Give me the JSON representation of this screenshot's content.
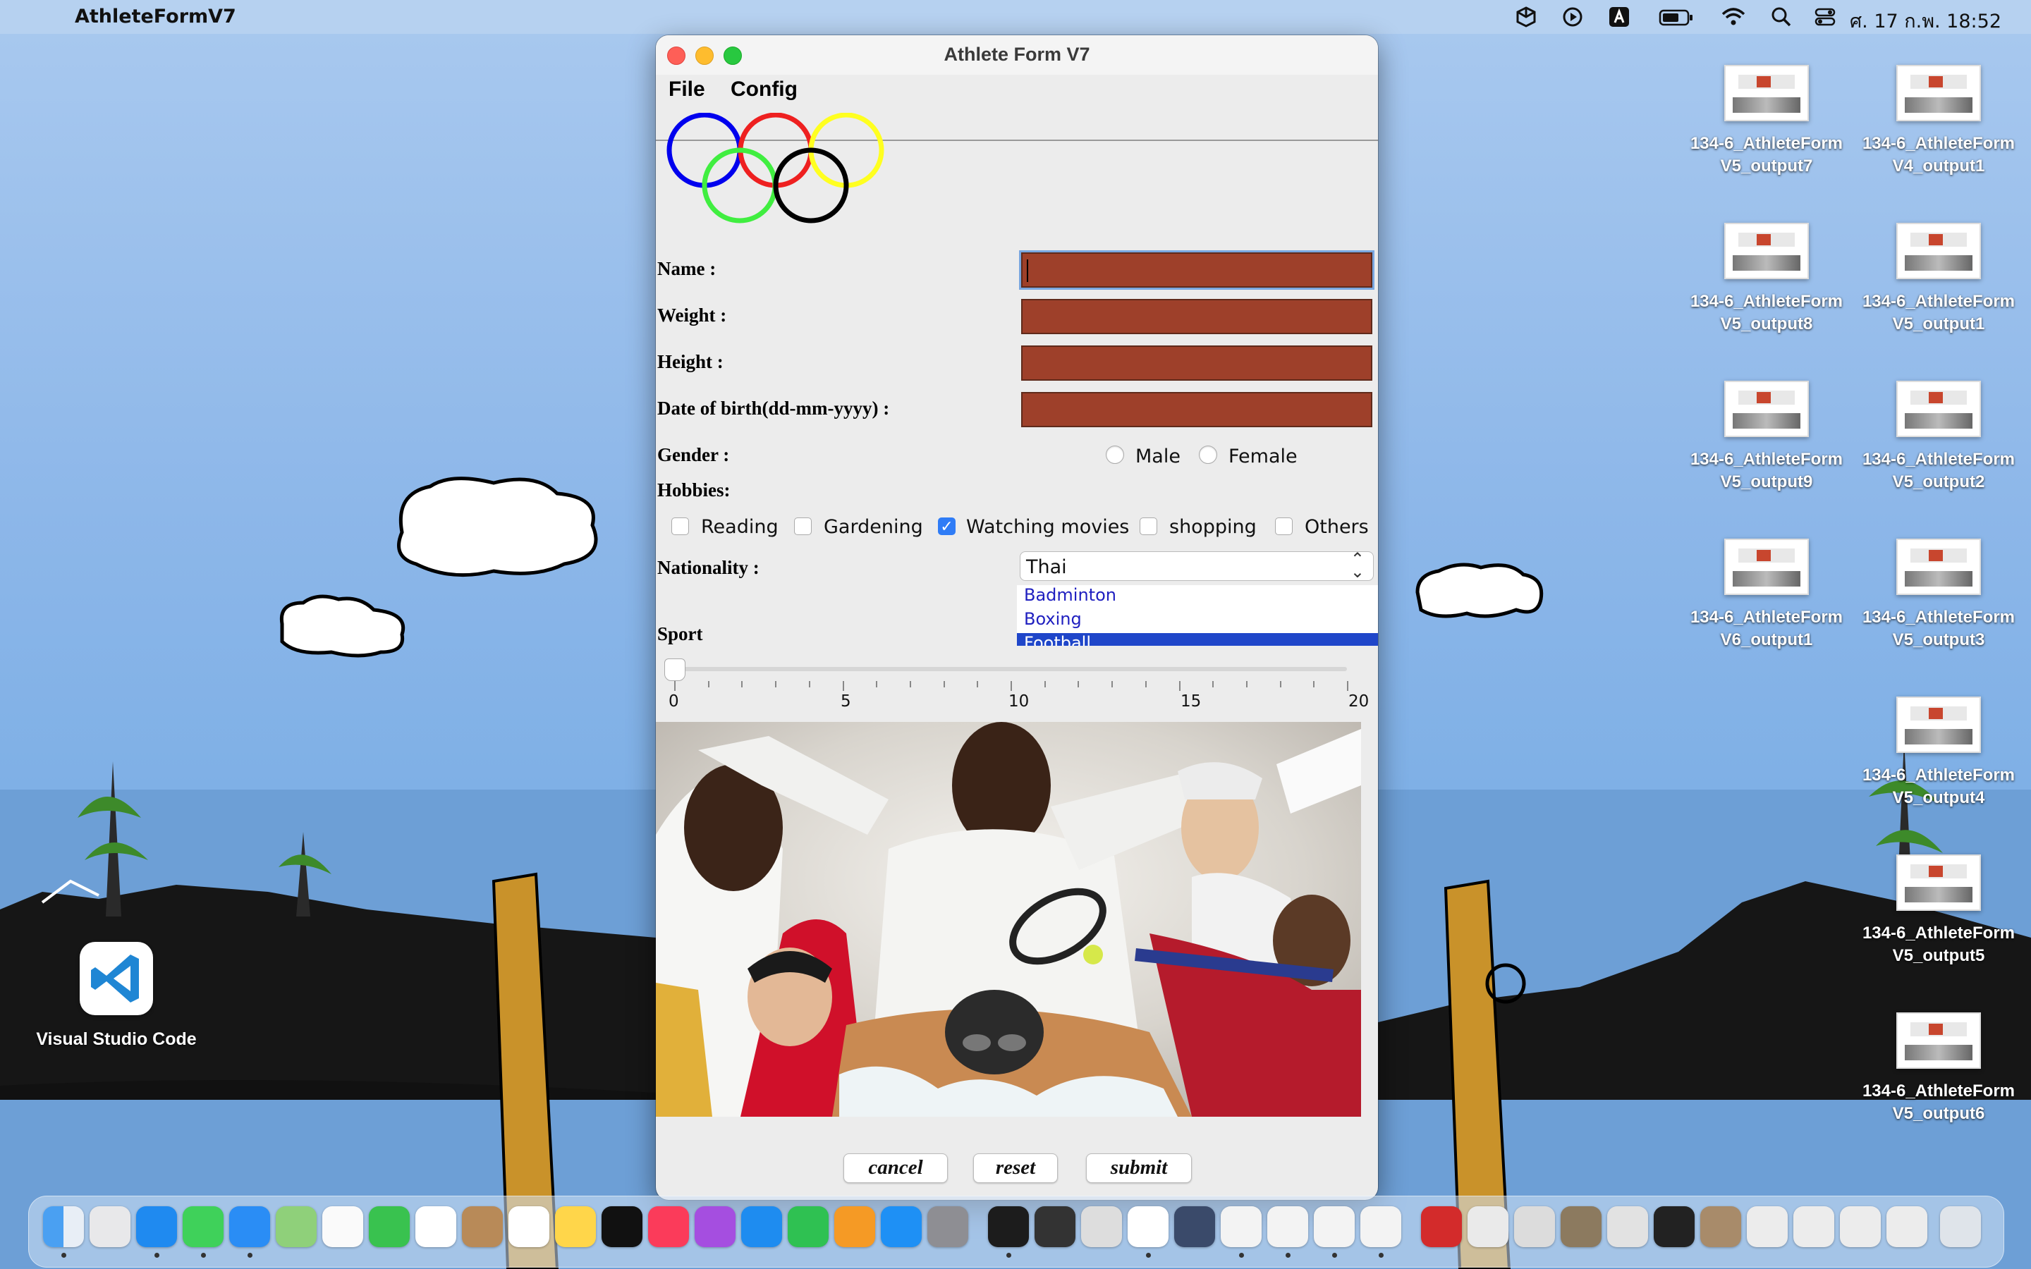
{
  "menubar": {
    "app_name": "AthleteFormV7",
    "clock": "ศ. 17 ก.พ.  18:52",
    "status_icons": [
      "cube-icon",
      "play-icon",
      "keyboard-input-icon",
      "battery-icon",
      "wifi-icon",
      "search-icon",
      "control-center-icon"
    ]
  },
  "desktop": {
    "files": [
      "134-6_AthleteFormV5_output7",
      "134-6_AthleteFormV4_output1",
      "134-6_AthleteFormV5_output8",
      "134-6_AthleteFormV5_output1",
      "134-6_AthleteFormV5_output9",
      "134-6_AthleteFormV5_output2",
      "134-6_AthleteFormV6_output1",
      "134-6_AthleteFormV5_output3",
      "134-6_AthleteFormV5_output4",
      "134-6_AthleteFormV5_output5",
      "134-6_AthleteFormV5_output6"
    ],
    "vscode_label": "Visual Studio Code"
  },
  "window": {
    "title": "Athlete Form V7",
    "menu": {
      "file": "File",
      "config": "Config"
    },
    "labels": {
      "name": "Name :",
      "weight": "Weight :",
      "height": "Height :",
      "dob": "Date of birth(dd-mm-yyyy) :",
      "gender": "Gender :",
      "hobbies": "Hobbies:",
      "nationality": "Nationality :",
      "sport": "Sport"
    },
    "fields": {
      "name": "",
      "weight": "",
      "height": "",
      "dob": ""
    },
    "gender_options": {
      "male": "Male",
      "female": "Female"
    },
    "hobbies": {
      "reading": "Reading",
      "gardening": "Gardening",
      "watching": "Watching movies",
      "shopping": "shopping",
      "others": "Others"
    },
    "hobbies_checked": [
      "Watching movies"
    ],
    "nationality": "Thai",
    "sports_list": {
      "item0": "Badminton",
      "item1": "Boxing",
      "item2": "Football"
    },
    "sport_selected": "Football",
    "slider": {
      "value": 0,
      "min": 0,
      "max": 20,
      "labels": {
        "l0": "0",
        "l5": "5",
        "l10": "10",
        "l15": "15",
        "l20": "20"
      }
    },
    "buttons": {
      "cancel": "cancel",
      "reset": "reset",
      "submit": "submit"
    },
    "colors": {
      "field_bg": "#9e402a",
      "list_selected": "#1f46c9",
      "list_text": "#2020c0"
    }
  }
}
